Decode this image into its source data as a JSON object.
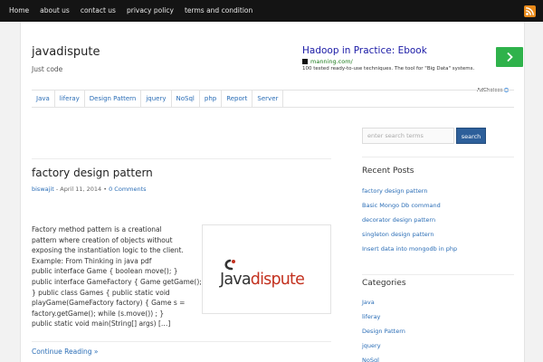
{
  "topbar": {
    "nav": [
      "Home",
      "about us",
      "contact us",
      "privacy policy",
      "terms and condition"
    ]
  },
  "site": {
    "title": "javadispute",
    "tagline": "Just code"
  },
  "ad": {
    "title": "Hadoop in Practice: Ebook",
    "url": "manning.com/",
    "description": "100 tested ready-to-use techniques. The tool for \"Big Data\" systems.",
    "adchoices": "AdChoices"
  },
  "menu": [
    "Java",
    "liferay",
    "Design Pattern",
    "jquery",
    "NoSql",
    "php",
    "Report",
    "Server"
  ],
  "search": {
    "placeholder": "enter search terms",
    "button": "search"
  },
  "post": {
    "title": "factory design pattern",
    "author": "biswajit",
    "separator": " - ",
    "date": "April 11, 2014",
    "bullet": " • ",
    "comments": "0 Comments",
    "excerpt_lines": [
      "Factory method pattern is a creational",
      "pattern where creation of objects without",
      "exposing the instantiation logic to the client.",
      "Example: From Thinking in java pdf",
      "public interface Game { boolean move(); }",
      "public interface GameFactory { Game getGame();",
      "}   public class Games { public static void",
      "playGame(GameFactory factory) { Game s =",
      "factory.getGame(); while (s.move()) ; }",
      "public static void main(String[] args) […]"
    ],
    "continue": "Continue Reading »",
    "thumb_logo": {
      "java": "Java",
      "dispute": "dispute"
    }
  },
  "sidebar": {
    "recent_title": "Recent Posts",
    "recent": [
      "factory design pattern",
      "Basic Mongo Db command",
      "decorator design pattern",
      "singleton design pattern",
      "Insert data into mongodb in php"
    ],
    "categories_title": "Categories",
    "categories": [
      "Java",
      "liferay",
      "Design Pattern",
      "jquery",
      "NoSql"
    ]
  },
  "colors": {
    "topbar": "#141414",
    "link": "#2a6db6",
    "search_button": "#2d5f9a",
    "logo_red": "#c3311f",
    "rss": "#e88a1a",
    "ad_button": "#2fb24b"
  },
  "icons": {
    "rss": "rss-icon",
    "ad_go": "chevron-right-icon",
    "adchoices": "adchoices-icon"
  }
}
